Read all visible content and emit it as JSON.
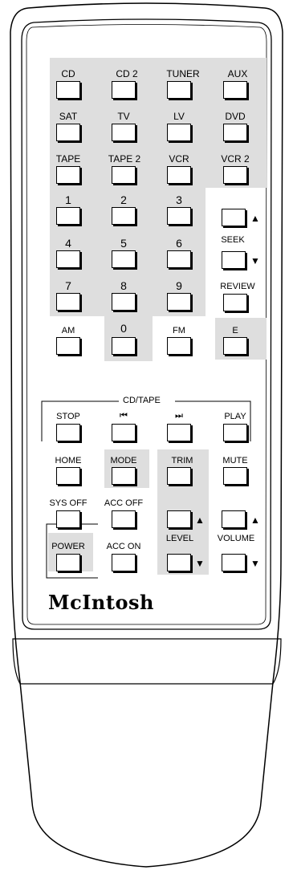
{
  "source_row": [
    "CD",
    "CD 2",
    "TUNER",
    "AUX"
  ],
  "source_row2": [
    "SAT",
    "TV",
    "LV",
    "DVD"
  ],
  "source_row3": [
    "TAPE",
    "TAPE 2",
    "VCR",
    "VCR 2"
  ],
  "digits": [
    "1",
    "2",
    "3",
    "4",
    "5",
    "6",
    "7",
    "8",
    "9",
    "0"
  ],
  "seek": "SEEK",
  "review": "REVIEW",
  "am": "AM",
  "fm": "FM",
  "e": "E",
  "transport_title": "CD/TAPE",
  "transport": [
    "STOP",
    "⏮",
    "⏭",
    "PLAY"
  ],
  "home": "HOME",
  "mode": "MODE",
  "trim": "TRIM",
  "mute": "MUTE",
  "sysoff": "SYS OFF",
  "accoff": "ACC OFF",
  "power": "POWER",
  "accon": "ACC ON",
  "level": "LEVEL",
  "volume": "VOLUME",
  "up": "▲",
  "down": "▼",
  "brand_main": "Mc",
  "brand_sup": "",
  "brand_rest": "Intosh"
}
